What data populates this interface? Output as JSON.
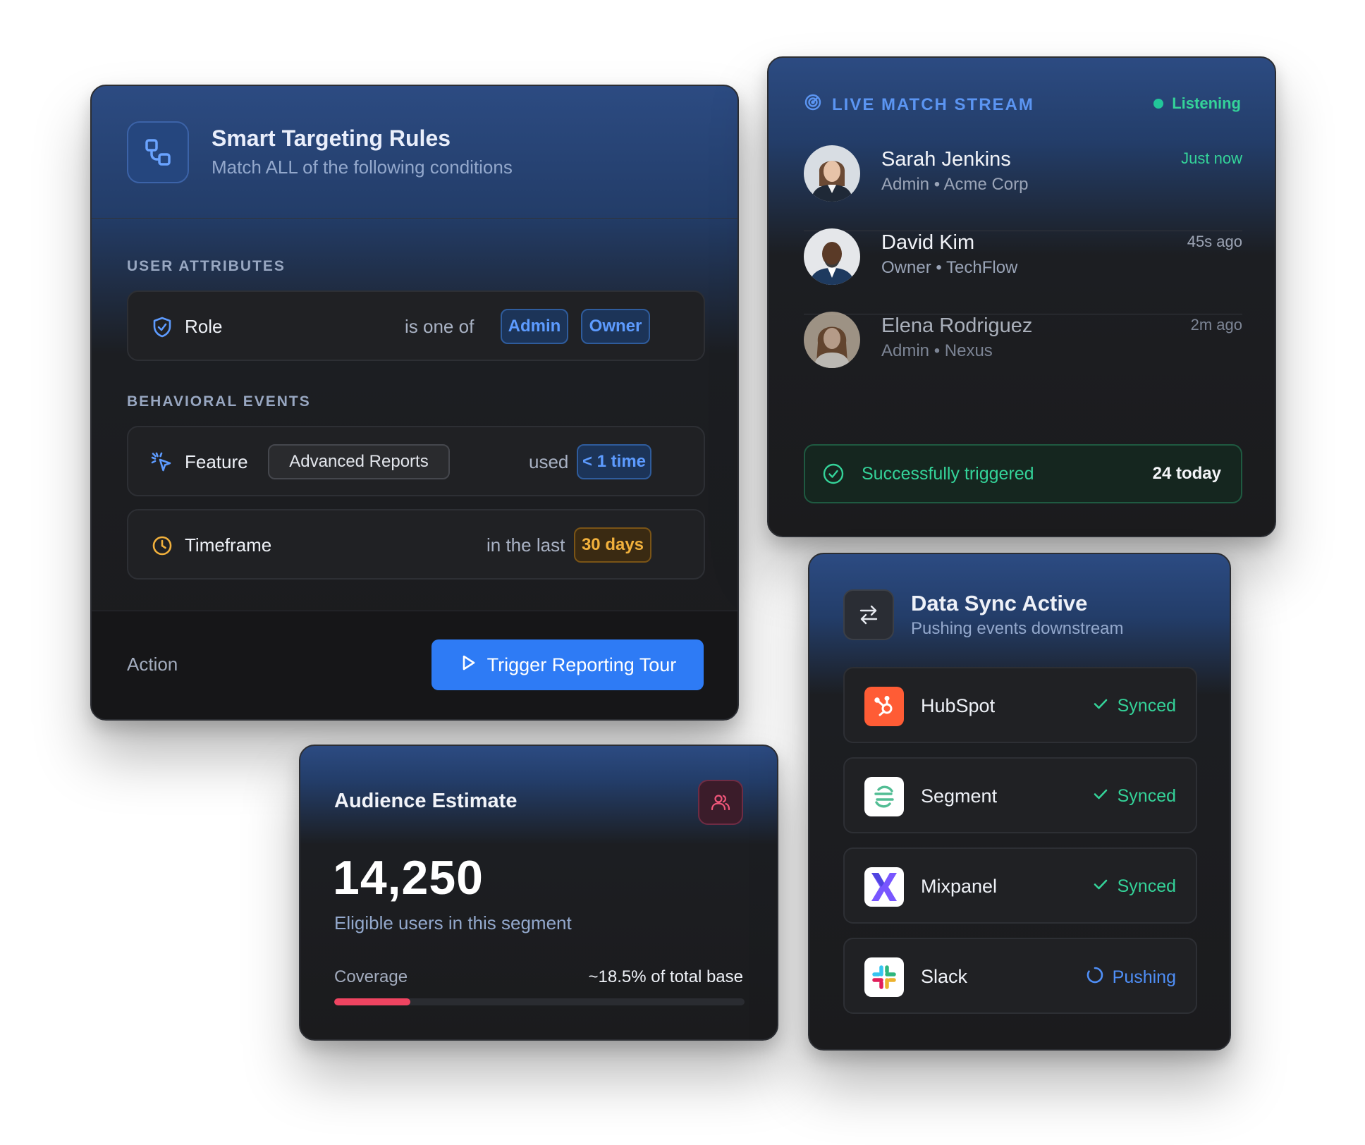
{
  "targeting": {
    "title": "Smart Targeting Rules",
    "subtitle": "Match ALL of the following conditions",
    "user_attributes_label": "USER ATTRIBUTES",
    "role": {
      "name": "Role",
      "operator": "is one of",
      "values": [
        "Admin",
        "Owner"
      ]
    },
    "behavioral_events_label": "BEHAVIORAL EVENTS",
    "feature": {
      "name": "Feature",
      "value": "Advanced Reports",
      "operator": "used",
      "count": "< 1 time"
    },
    "timeframe": {
      "name": "Timeframe",
      "operator": "in the last",
      "value": "30 days"
    },
    "action_label": "Action",
    "cta_label": "Trigger Reporting Tour",
    "colors": {
      "accent": "#2e7bf5",
      "amber": "#f2b13c"
    }
  },
  "live": {
    "title": "LIVE MATCH STREAM",
    "status": "Listening",
    "matches": [
      {
        "name": "Sarah Jenkins",
        "role": "Admin",
        "company": "Acme Corp",
        "time": "Just now"
      },
      {
        "name": "David Kim",
        "role": "Owner",
        "company": "TechFlow",
        "time": "45s ago"
      },
      {
        "name": "Elena Rodriguez",
        "role": "Admin",
        "company": "Nexus",
        "time": "2m ago"
      }
    ],
    "separator": "•",
    "success_label": "Successfully triggered",
    "success_count": "24 today",
    "colors": {
      "success": "#34d399"
    }
  },
  "audience": {
    "title": "Audience Estimate",
    "count": "14,250",
    "subtitle": "Eligible users in this segment",
    "coverage_label": "Coverage",
    "coverage_text": "~18.5% of total base",
    "coverage_fraction": 0.185,
    "colors": {
      "bar": "#ef4461"
    }
  },
  "sync": {
    "title": "Data Sync Active",
    "subtitle": "Pushing events downstream",
    "integrations": [
      {
        "name": "HubSpot",
        "status": "Synced",
        "icon": "hubspot-logo"
      },
      {
        "name": "Segment",
        "status": "Synced",
        "icon": "segment-logo"
      },
      {
        "name": "Mixpanel",
        "status": "Synced",
        "icon": "mixpanel-logo"
      },
      {
        "name": "Slack",
        "status": "Pushing",
        "icon": "slack-logo"
      }
    ]
  }
}
